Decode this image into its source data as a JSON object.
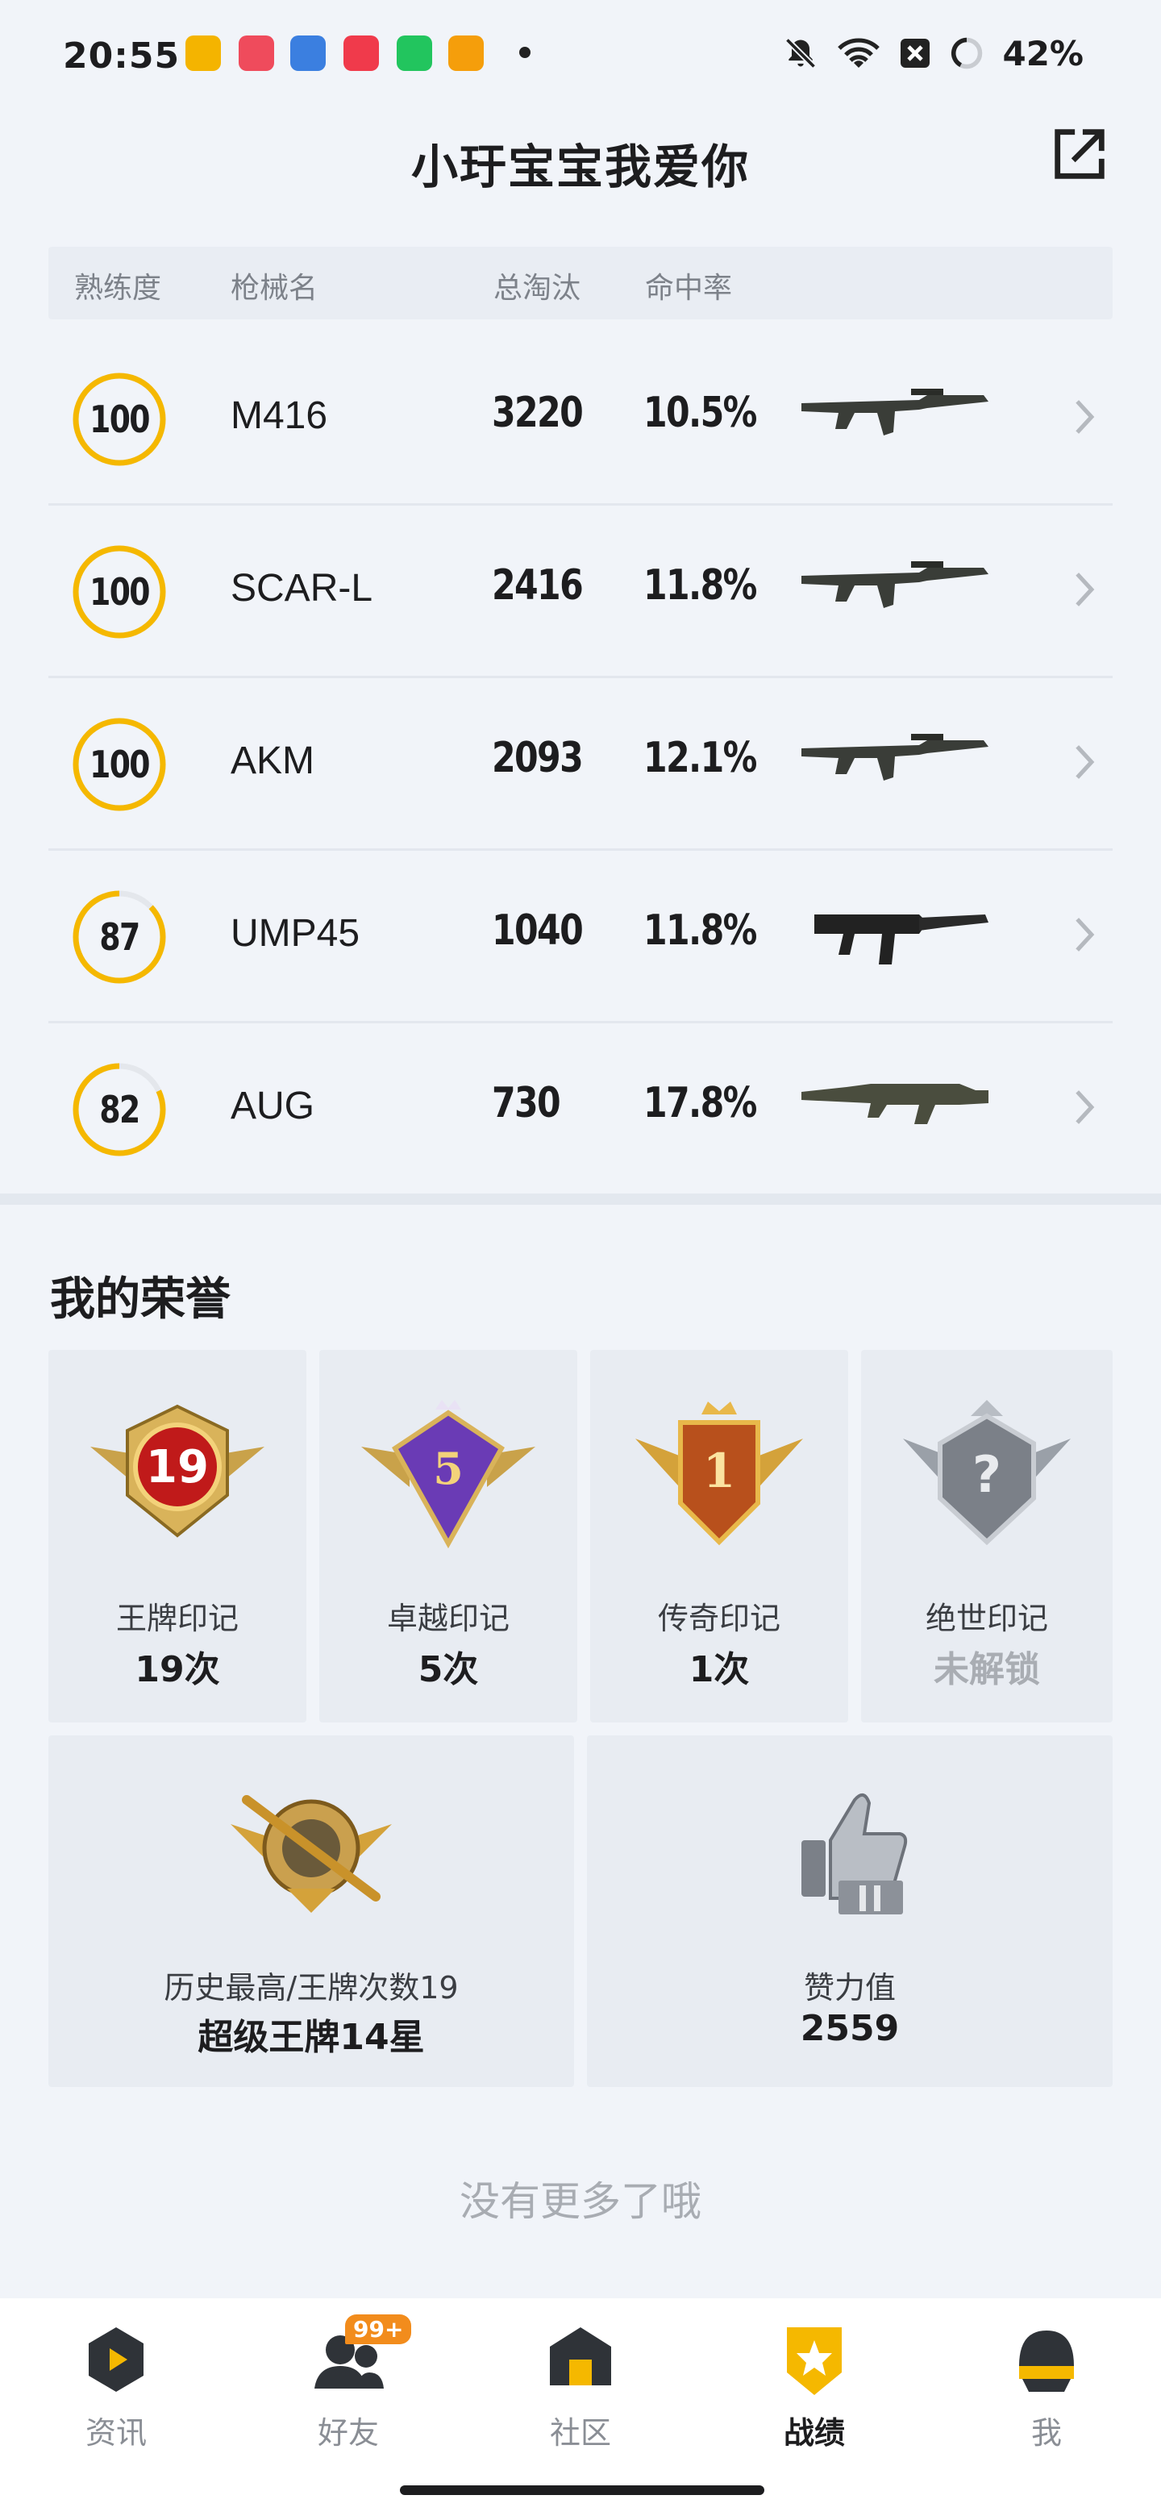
{
  "status_bar": {
    "time": "20:55",
    "battery": "42%"
  },
  "header": {
    "title": "小玗宝宝我爱你"
  },
  "table": {
    "columns": [
      "熟练度",
      "枪械名",
      "总淘汰",
      "命中率"
    ],
    "rows": [
      {
        "mastery": "100",
        "mastery_level": 100,
        "name": "M416",
        "kills": "3220",
        "accuracy": "10.5%",
        "gun_icon": "assault-rifle-icon"
      },
      {
        "mastery": "100",
        "mastery_level": 100,
        "name": "SCAR-L",
        "kills": "2416",
        "accuracy": "11.8%",
        "gun_icon": "assault-rifle-icon"
      },
      {
        "mastery": "100",
        "mastery_level": 100,
        "name": "AKM",
        "kills": "2093",
        "accuracy": "12.1%",
        "gun_icon": "assault-rifle-icon"
      },
      {
        "mastery": "87",
        "mastery_level": 87,
        "name": "UMP45",
        "kills": "1040",
        "accuracy": "11.8%",
        "gun_icon": "smg-icon"
      },
      {
        "mastery": "82",
        "mastery_level": 82,
        "name": "AUG",
        "kills": "730",
        "accuracy": "17.8%",
        "gun_icon": "bullpup-rifle-icon"
      }
    ]
  },
  "honors": {
    "title": "我的荣誉",
    "badges": [
      {
        "label": "王牌印记",
        "value": "19次",
        "emblem_text": "19",
        "icon": "ace-emblem-icon"
      },
      {
        "label": "卓越印记",
        "value": "5次",
        "emblem_text": "5",
        "icon": "excellence-emblem-icon"
      },
      {
        "label": "传奇印记",
        "value": "1次",
        "emblem_text": "1",
        "icon": "legend-emblem-icon"
      },
      {
        "label": "绝世印记",
        "value": "未解锁",
        "emblem_text": "?",
        "icon": "locked-emblem-icon"
      }
    ],
    "wide": [
      {
        "label": "历史最高/王牌次数19",
        "value": "超级王牌14星",
        "icon": "sniper-rank-emblem-icon"
      },
      {
        "label": "赞力值",
        "value": "2559",
        "icon": "thumbs-up-trophy-icon"
      }
    ]
  },
  "footer_text": "没有更多了哦",
  "tabbar": {
    "items": [
      {
        "label": "资讯",
        "icon": "news-icon",
        "active": false
      },
      {
        "label": "好友",
        "icon": "friends-icon",
        "active": false,
        "badge": "99+"
      },
      {
        "label": "社区",
        "icon": "community-icon",
        "active": false
      },
      {
        "label": "战绩",
        "icon": "record-icon",
        "active": true
      },
      {
        "label": "我",
        "icon": "profile-icon",
        "active": false
      }
    ]
  },
  "colors": {
    "accent": "#f5b800",
    "ring_track": "#e4e7ec",
    "badge": "#f28c1c"
  }
}
